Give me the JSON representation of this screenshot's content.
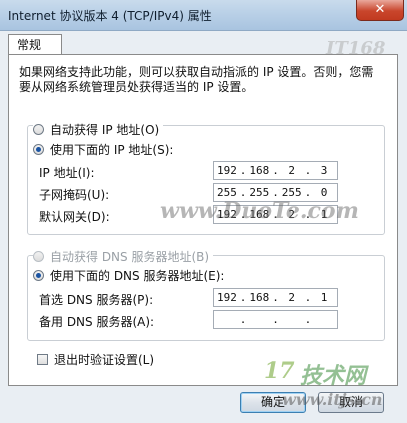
{
  "window": {
    "title": "Internet 协议版本 4 (TCP/IPv4) 属性",
    "close_glyph": "✕"
  },
  "tabs": [
    {
      "label": "常规"
    }
  ],
  "intro": "如果网络支持此功能，则可以获取自动指派的 IP 设置。否则，您需要从网络系统管理员处获得适当的 IP 设置。",
  "ip_mode": {
    "auto_label": "自动获得 IP 地址(O)",
    "manual_label": "使用下面的 IP 地址(S):",
    "selected": "manual"
  },
  "ip_fields": [
    {
      "label": "IP 地址(I):",
      "octets": [
        "192",
        "168",
        "2",
        "3"
      ]
    },
    {
      "label": "子网掩码(U):",
      "octets": [
        "255",
        "255",
        "255",
        "0"
      ]
    },
    {
      "label": "默认网关(D):",
      "octets": [
        "192",
        "168",
        "2",
        "1"
      ]
    }
  ],
  "dns_mode": {
    "auto_label": "自动获得 DNS 服务器地址(B)",
    "manual_label": "使用下面的 DNS 服务器地址(E):",
    "selected": "manual"
  },
  "dns_fields": [
    {
      "label": "首选 DNS 服务器(P):",
      "octets": [
        "192",
        "168",
        "2",
        "1"
      ]
    },
    {
      "label": "备用 DNS 服务器(A):",
      "octets": [
        "",
        "",
        "",
        ""
      ]
    }
  ],
  "validate_on_exit": {
    "label": "退出时验证设置(L)",
    "checked": false
  },
  "buttons": {
    "ok": "确定",
    "cancel": "取消"
  },
  "watermarks": {
    "center": "www.DuoTe.com",
    "top_right": "IT168",
    "bottom_right_logo": "17",
    "bottom_right_name": "技术网",
    "bottom_url": "www.itjs.cn"
  }
}
